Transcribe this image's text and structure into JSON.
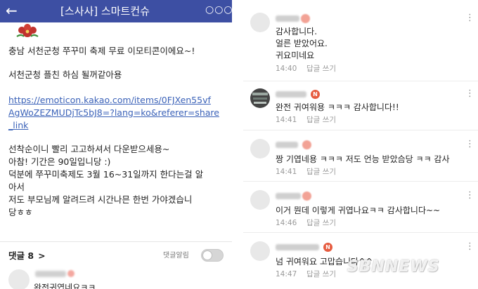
{
  "left": {
    "header": {
      "back_icon": "arrow-left-icon",
      "title": "[스사사] 스마트컨슈",
      "more_icon": "more-dots-icon"
    },
    "post_lines": [
      "충남 서천군청 쭈꾸미 축제 무료 이모티콘이에요~!",
      "서천군청 플친 하심 될꺼같아용",
      "https://emoticon.kakao.com/items/0FJXen55vf",
      "AgWoZEZMUDjTc5bJ8=?lang=ko&referer=share",
      "_link",
      "선착순이니 빨리 고고하셔서 다운받으세용~",
      "아참! 기간은 90일입니당 :)",
      "덕분에 쭈꾸미축제도 3월 16~31일까지 한다는걸 알",
      "아서",
      "저도 부모님께 알려드려 시간나믄 한번 가야겠습니",
      "당ㅎㅎ"
    ],
    "comments_label": "댓글 8",
    "comments_chevron": ">",
    "alarm_label": "댓글알림",
    "alarm_on": false,
    "first_comment_text": "완전귀엽네요ㅋㅋ"
  },
  "right": {
    "comments": [
      {
        "lines": [
          "감사합니다.",
          "얼른 받았어요.",
          "귀요미네요"
        ],
        "time": "14:40",
        "reply": "답글 쓰기",
        "badge": ""
      },
      {
        "lines": [
          "완전 귀여워용 ㅋㅋㅋ 감사합니다!!"
        ],
        "time": "14:41",
        "reply": "답글 쓰기",
        "badge": "N"
      },
      {
        "lines": [
          "짱 기엽네용 ㅋㅋㅋ 저도 언능 받았슴당 ㅋㅋ 감사"
        ],
        "time": "14:41",
        "reply": "답글 쓰기",
        "badge": ""
      },
      {
        "lines": [
          "이거 뭔데 이렇게 귀엽나요ㅋㅋ 감사합니다~~"
        ],
        "time": "14:46",
        "reply": "답글 쓰기",
        "badge": ""
      },
      {
        "lines": [
          "넘 귀여워요 고맙습니다^^"
        ],
        "time": "14:47",
        "reply": "답글 쓰기",
        "badge": "N"
      }
    ],
    "kebab_icon": "more-vertical-icon"
  },
  "watermark": "SBNNEWS",
  "colors": {
    "header_bg": "#3d4fa3",
    "link": "#3b62b8",
    "badge": "#e65c40"
  }
}
